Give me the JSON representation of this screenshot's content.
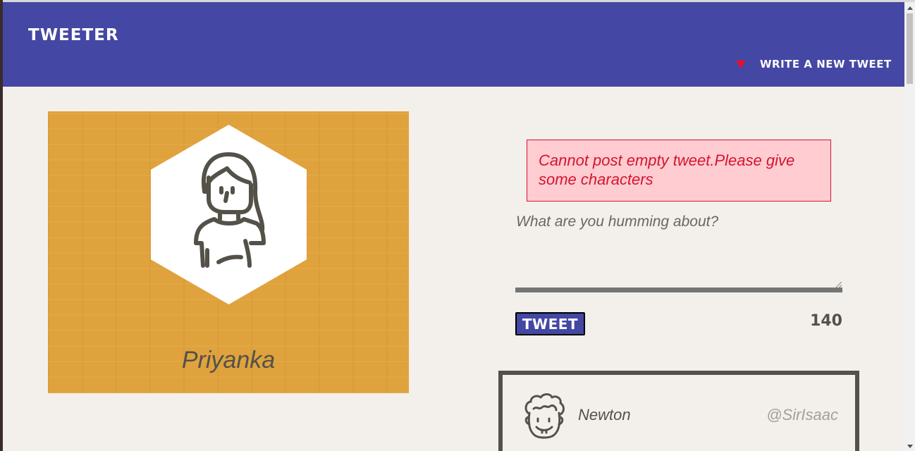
{
  "app": {
    "brand": "TWEETER",
    "compose_toggle_label": "WRITE A NEW TWEET"
  },
  "profile": {
    "name": "Priyanka",
    "avatar_icon": "woman-avatar-icon"
  },
  "composer": {
    "error_message": "Cannot post empty tweet.Please give some characters",
    "placeholder": "What are you humming about?",
    "value": "",
    "submit_label": "TWEET",
    "char_counter": "140"
  },
  "tweets": [
    {
      "author": "Newton",
      "handle": "@SirIsaac",
      "avatar_icon": "curly-hair-man-avatar-icon"
    }
  ],
  "colors": {
    "nav_bg": "#4447a3",
    "page_bg": "#f3f0ec",
    "profile_bg": "#dfa23c",
    "error_bg": "#ffccd1",
    "error_text": "#d6132f",
    "text": "#545149",
    "accent_arrow": "#e8102b"
  }
}
